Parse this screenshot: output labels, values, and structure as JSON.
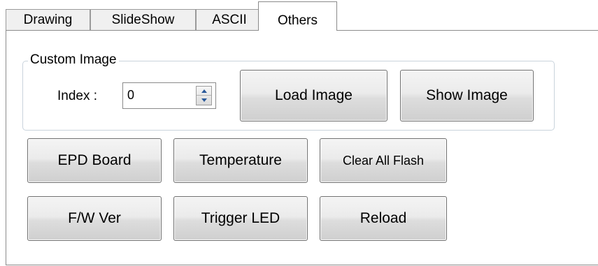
{
  "tabs": [
    {
      "label": "Drawing"
    },
    {
      "label": "SlideShow"
    },
    {
      "label": "ASCII"
    },
    {
      "label": "Others",
      "active": true
    }
  ],
  "custom_image": {
    "title": "Custom Image",
    "index_label": "Index :",
    "index_value": "0",
    "load_label": "Load Image",
    "show_label": "Show Image"
  },
  "buttons": {
    "epd_board": "EPD Board",
    "temperature": "Temperature",
    "clear_all_flash": "Clear All Flash",
    "fw_ver": "F/W Ver",
    "trigger_led": "Trigger LED",
    "reload": "Reload"
  }
}
